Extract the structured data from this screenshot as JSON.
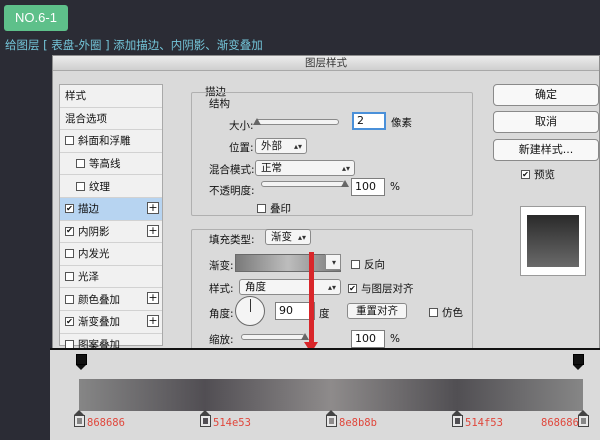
{
  "tag": "NO.6-1",
  "caption": "给图层 [ 表盘-外圈 ] 添加描边、内阴影、渐变叠加",
  "dialog": {
    "title": "图层样式",
    "style_list": [
      {
        "label": "样式",
        "checkbox": false,
        "checked": false,
        "plus": false,
        "indent": false,
        "active": false
      },
      {
        "label": "混合选项",
        "checkbox": false,
        "checked": false,
        "plus": false,
        "indent": false,
        "active": false
      },
      {
        "label": "斜面和浮雕",
        "checkbox": true,
        "checked": false,
        "plus": false,
        "indent": false,
        "active": false
      },
      {
        "label": "等高线",
        "checkbox": true,
        "checked": false,
        "plus": false,
        "indent": true,
        "active": false
      },
      {
        "label": "纹理",
        "checkbox": true,
        "checked": false,
        "plus": false,
        "indent": true,
        "active": false
      },
      {
        "label": "描边",
        "checkbox": true,
        "checked": true,
        "plus": true,
        "indent": false,
        "active": true
      },
      {
        "label": "内阴影",
        "checkbox": true,
        "checked": true,
        "plus": true,
        "indent": false,
        "active": false
      },
      {
        "label": "内发光",
        "checkbox": true,
        "checked": false,
        "plus": false,
        "indent": false,
        "active": false
      },
      {
        "label": "光泽",
        "checkbox": true,
        "checked": false,
        "plus": false,
        "indent": false,
        "active": false
      },
      {
        "label": "颜色叠加",
        "checkbox": true,
        "checked": false,
        "plus": true,
        "indent": false,
        "active": false
      },
      {
        "label": "渐变叠加",
        "checkbox": true,
        "checked": true,
        "plus": true,
        "indent": false,
        "active": false
      },
      {
        "label": "图案叠加",
        "checkbox": true,
        "checked": false,
        "plus": false,
        "indent": false,
        "active": false
      }
    ],
    "stroke": {
      "section_title": "描边",
      "structure_title": "结构",
      "size_label": "大小:",
      "size_value": "2",
      "size_level": 0.02,
      "size_unit": "像素",
      "position_label": "位置:",
      "position_value": "外部",
      "blend_label": "混合模式:",
      "blend_value": "正常",
      "opacity_label": "不透明度:",
      "opacity_value": "100",
      "opacity_level": 1.0,
      "opacity_unit": "%",
      "overprint_label": "叠印"
    },
    "fill": {
      "fill_type_label": "填充类型:",
      "fill_type_value": "渐变",
      "gradient_label": "渐变:",
      "reverse_label": "反向",
      "style_label": "样式:",
      "style_value": "角度",
      "align_label": "与图层对齐",
      "align_checked": true,
      "angle_label": "角度:",
      "angle_value": "90",
      "angle_unit": "度",
      "reset_align_label": "重置对齐",
      "dither_label": "仿色",
      "scale_label": "缩放:",
      "scale_value": "100",
      "scale_level": 1.0,
      "scale_unit": "%"
    },
    "buttons": {
      "ok": "确定",
      "cancel": "取消",
      "new_style": "新建样式...",
      "preview_label": "预览",
      "preview_checked": true
    }
  },
  "gradient_editor": {
    "stops": [
      {
        "color": "#868686",
        "label": "868686"
      },
      {
        "color": "#514e53",
        "label": "514e53"
      },
      {
        "color": "#8e8b8b",
        "label": "8e8b8b"
      },
      {
        "color": "#514f53",
        "label": "514f53"
      },
      {
        "color": "#868686",
        "label": "868686"
      }
    ]
  },
  "colors": {
    "tag_bg": "#5ec08a",
    "caption": "#73c4d8",
    "arrow": "#d9262a",
    "hex_text": "#e0473c",
    "selected_row": "#b7d4f1"
  }
}
